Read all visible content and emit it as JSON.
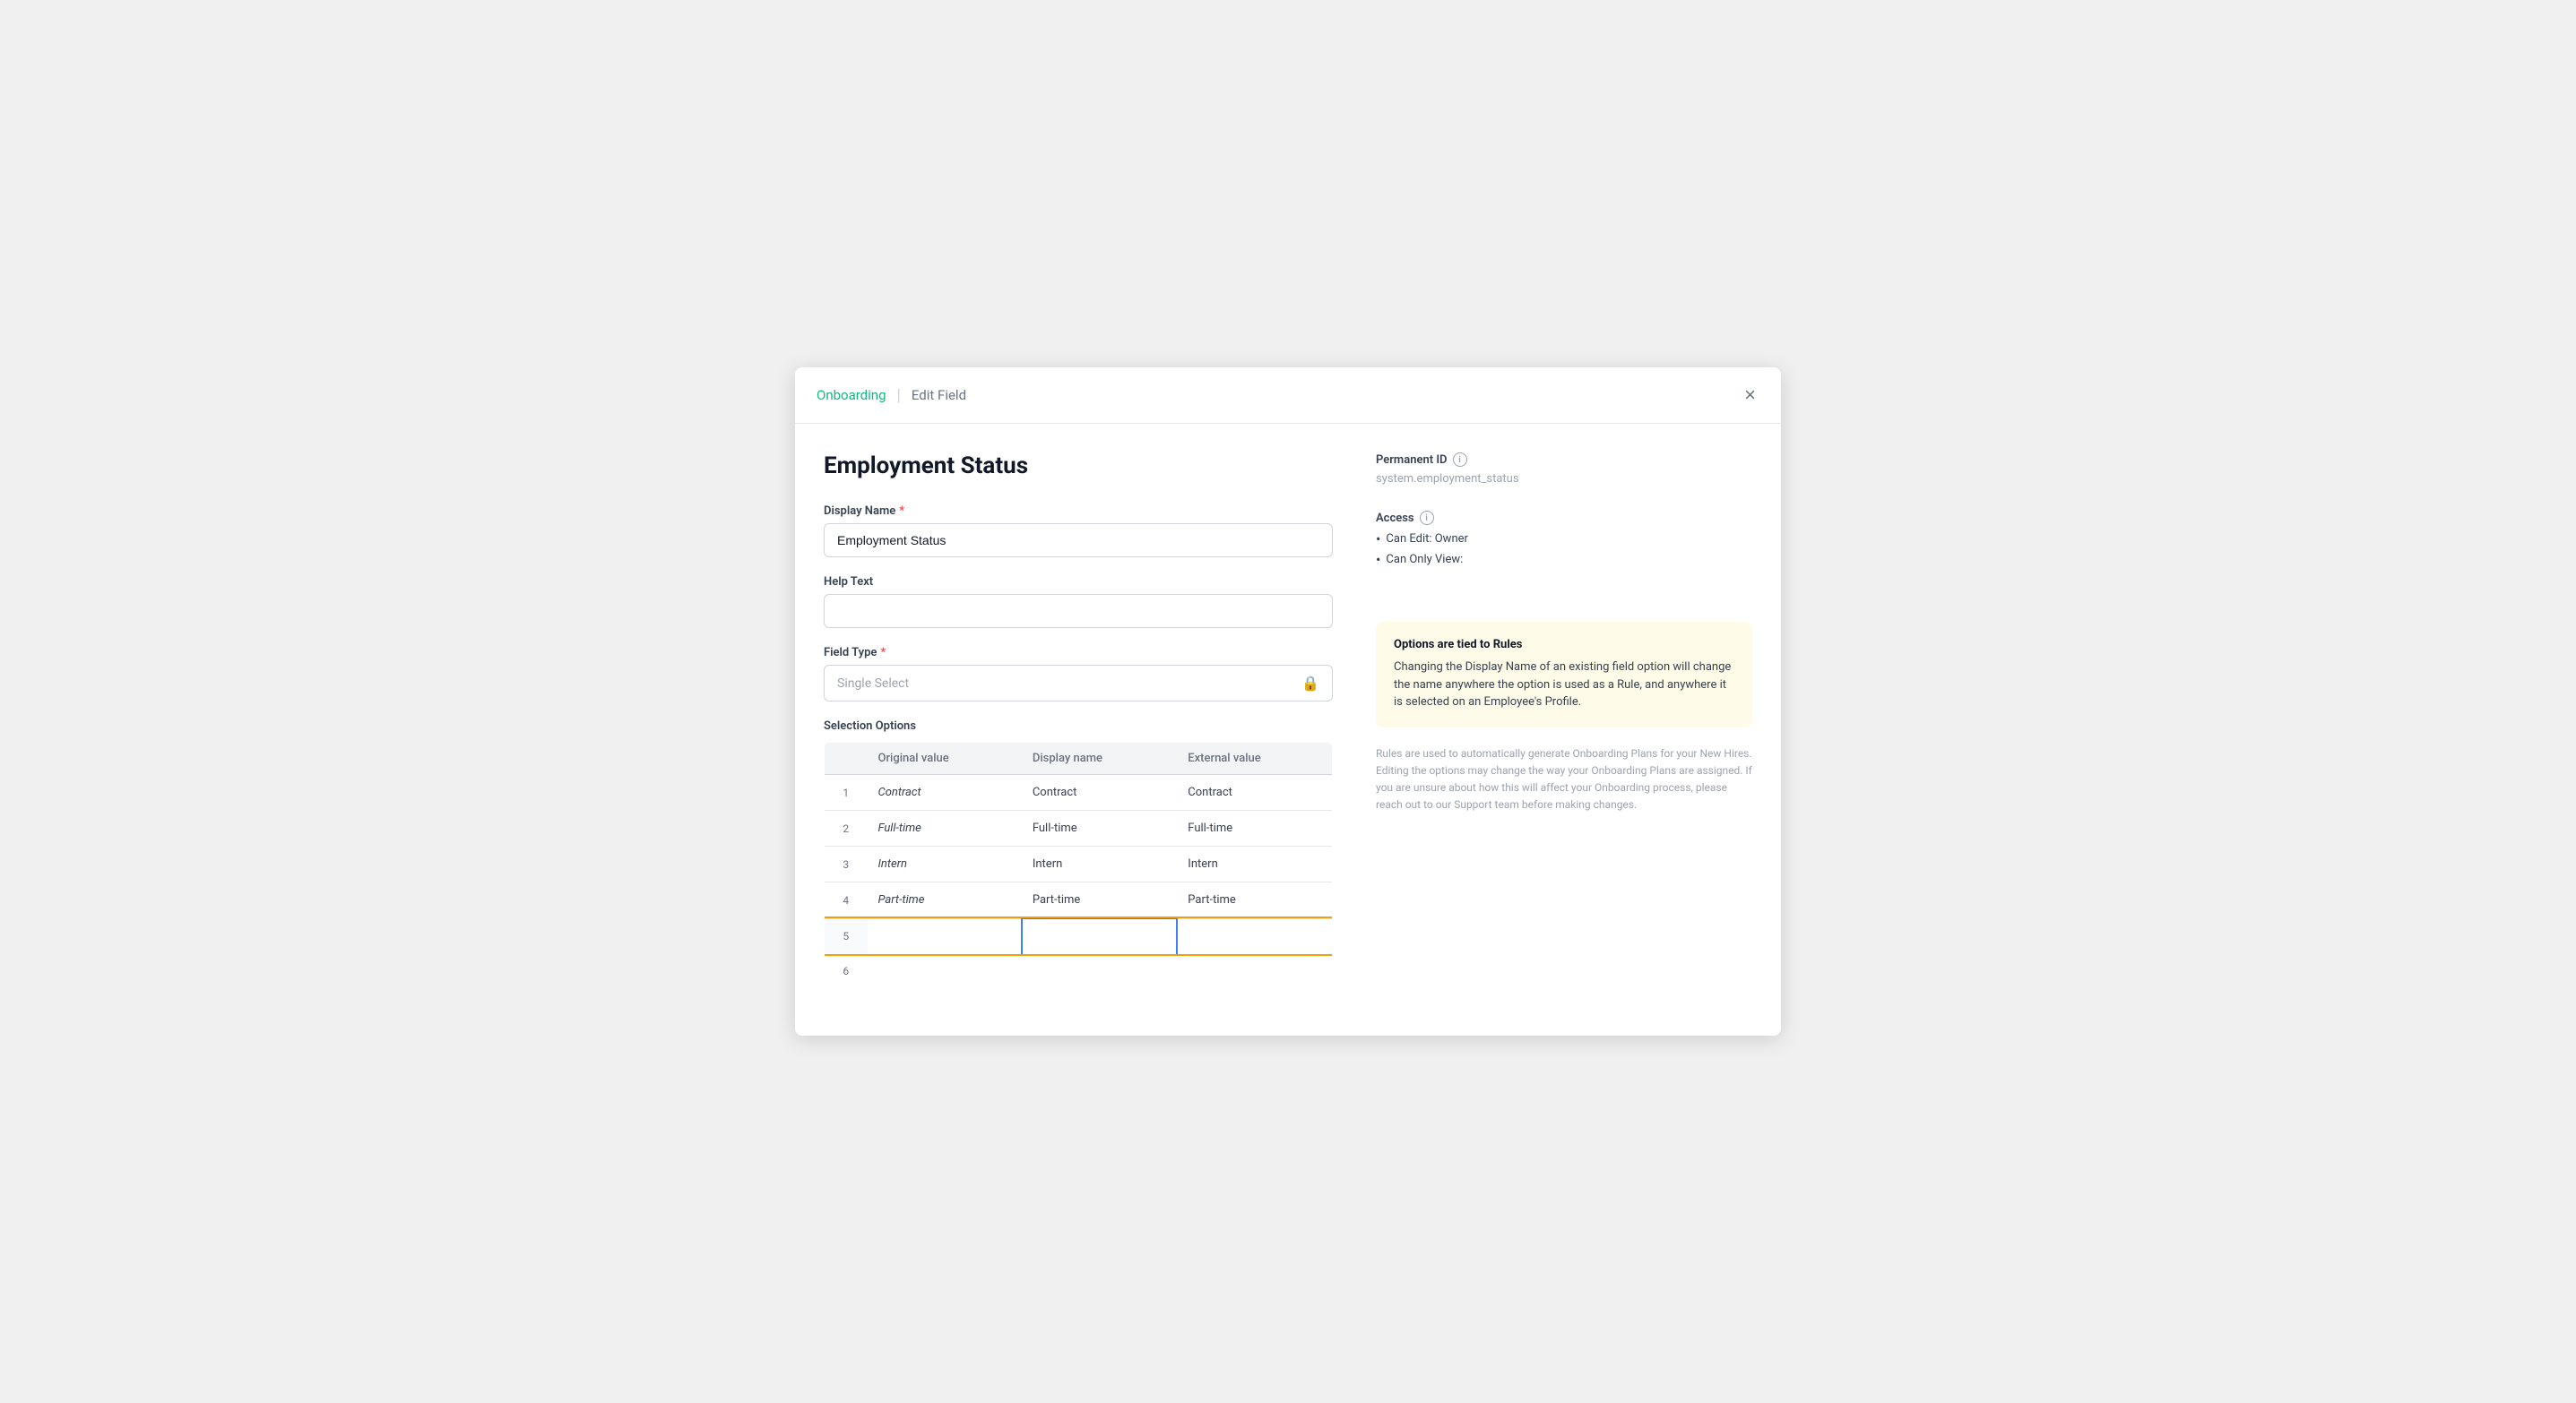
{
  "modal": {
    "breadcrumb": {
      "step1": "Onboarding",
      "step2": "Edit Field"
    },
    "close_label": "×"
  },
  "form": {
    "title": "Employment Status",
    "display_name_label": "Display Name",
    "display_name_required": true,
    "display_name_value": "Employment Status",
    "help_text_label": "Help Text",
    "help_text_value": "",
    "field_type_label": "Field Type",
    "field_type_required": true,
    "field_type_value": "Single Select",
    "selection_options_label": "Selection Options",
    "table": {
      "headers": [
        "",
        "Original value",
        "Display name",
        "External value"
      ],
      "rows": [
        {
          "num": 1,
          "original": "Contract",
          "display": "Contract",
          "external": "Contract"
        },
        {
          "num": 2,
          "original": "Full-time",
          "display": "Full-time",
          "external": "Full-time"
        },
        {
          "num": 3,
          "original": "Intern",
          "display": "Intern",
          "external": "Intern"
        },
        {
          "num": 4,
          "original": "Part-time",
          "display": "Part-time",
          "external": "Part-time"
        },
        {
          "num": 5,
          "original": "",
          "display": "",
          "external": ""
        },
        {
          "num": 6,
          "original": "",
          "display": "",
          "external": ""
        }
      ]
    }
  },
  "right": {
    "permanent_id_label": "Permanent ID",
    "permanent_id_value": "system.employment_status",
    "access_label": "Access",
    "access_items": [
      "Can Edit: Owner",
      "Can Only View:"
    ],
    "info_box": {
      "title": "Options are tied to Rules",
      "text": "Changing the Display Name of an existing field option will change the name anywhere the option is used as a Rule, and anywhere it is selected on an Employee's Profile."
    },
    "rules_text": "Rules are used to automatically generate Onboarding Plans for your New Hires. Editing the options may change the way your Onboarding Plans are assigned. If you are unsure about how this will affect your Onboarding process, please reach out to our Support team before making changes."
  },
  "icons": {
    "lock": "🔒",
    "info": "i",
    "close": "✕"
  }
}
